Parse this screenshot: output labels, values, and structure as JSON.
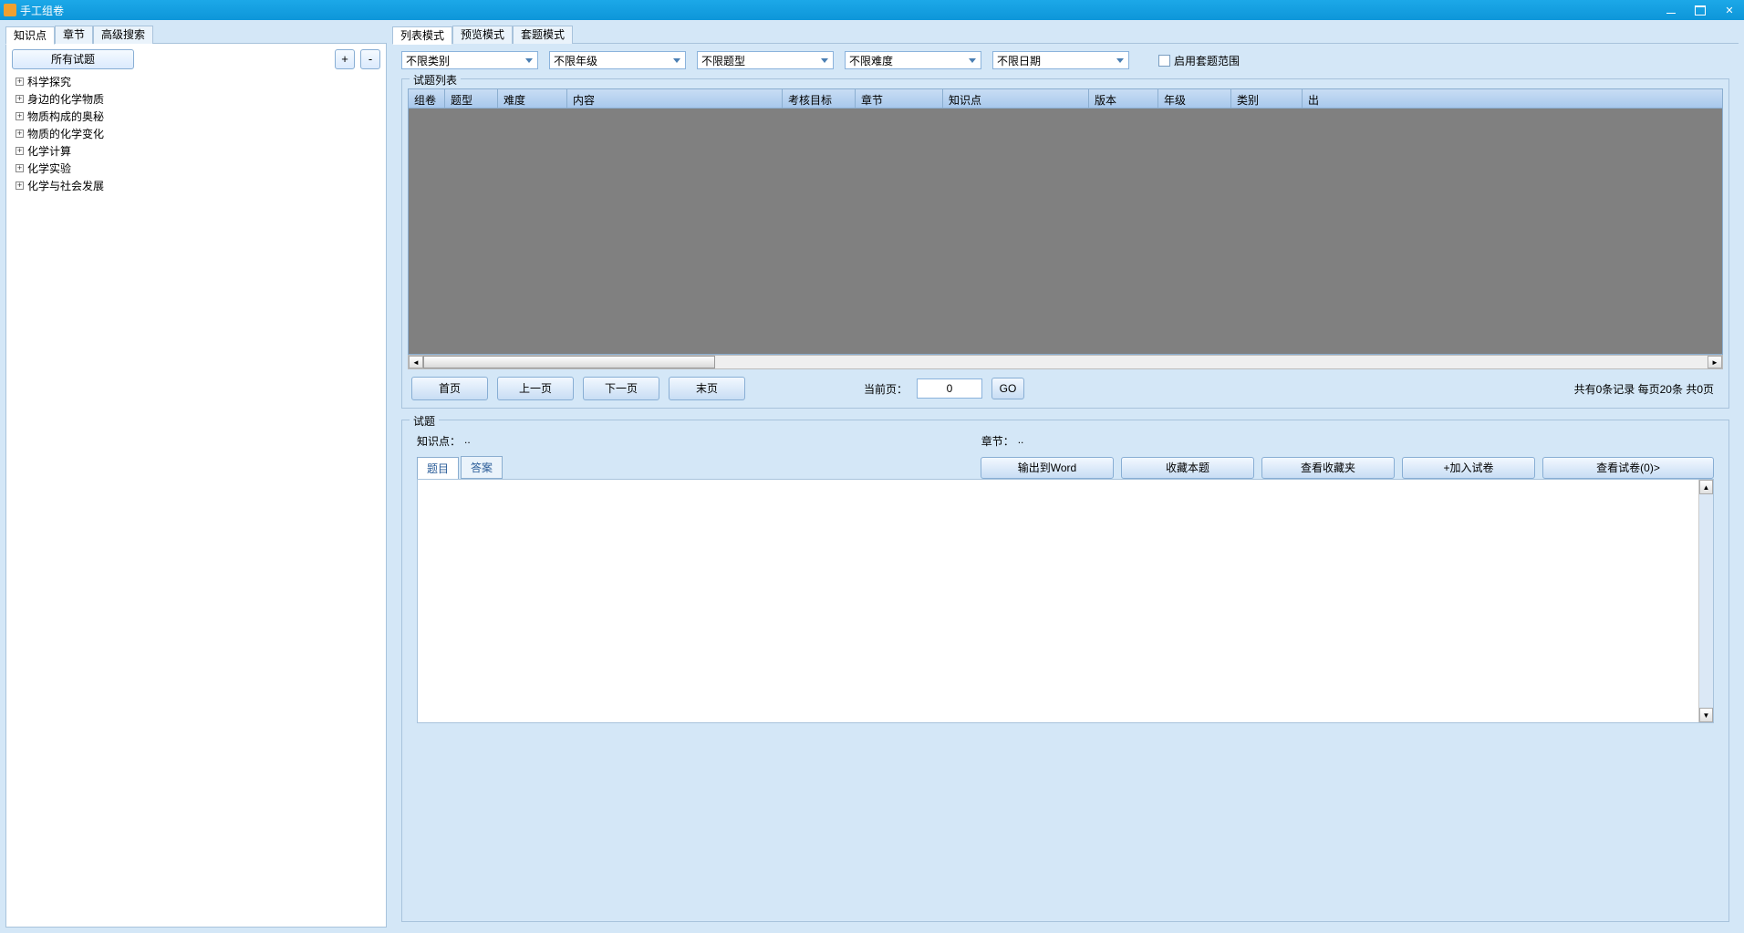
{
  "window": {
    "title": "手工组卷"
  },
  "leftTabs": [
    "知识点",
    "章节",
    "高级搜索"
  ],
  "allQuestionsBtn": "所有试题",
  "expandBtn": "+",
  "collapseBtn": "-",
  "treeItems": [
    "科学探究",
    "身边的化学物质",
    "物质构成的奥秘",
    "物质的化学变化",
    "化学计算",
    "化学实验",
    "化学与社会发展"
  ],
  "rightTabs": [
    "列表模式",
    "预览模式",
    "套题模式"
  ],
  "filters": {
    "category": "不限类别",
    "grade": "不限年级",
    "qtype": "不限题型",
    "difficulty": "不限难度",
    "date": "不限日期",
    "enableSet": "启用套题范围"
  },
  "gridTitle": "试题列表",
  "gridColumns": [
    "组卷",
    "题型",
    "难度",
    "内容",
    "考核目标",
    "章节",
    "知识点",
    "版本",
    "年级",
    "类别",
    "出"
  ],
  "pager": {
    "first": "首页",
    "prev": "上一页",
    "next": "下一页",
    "last": "末页",
    "currentLabel": "当前页：",
    "currentValue": "0",
    "go": "GO",
    "summary": "共有0条记录 每页20条 共0页"
  },
  "detail": {
    "groupTitle": "试题",
    "kpLabel": "知识点：",
    "kpValue": "..",
    "chLabel": "章节：",
    "chValue": ".."
  },
  "innerTabs": [
    "题目",
    "答案"
  ],
  "actions": {
    "exportWord": "输出到Word",
    "fav": "收藏本题",
    "viewFav": "查看收藏夹",
    "add": "+加入试卷",
    "viewPaper": "查看试卷(0)>"
  }
}
